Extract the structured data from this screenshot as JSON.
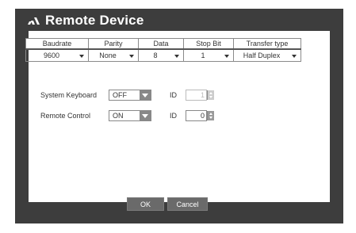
{
  "title": "Remote Device",
  "table": {
    "headers": [
      "Baudrate",
      "Parity",
      "Data",
      "Stop Bit",
      "Transfer type"
    ],
    "values": [
      "9600",
      "None",
      "8",
      "1",
      "Half Duplex"
    ]
  },
  "system_keyboard": {
    "label": "System Keyboard",
    "value": "OFF",
    "id_label": "ID",
    "id_value": "1",
    "id_enabled": false
  },
  "remote_control": {
    "label": "Remote Control",
    "value": "ON",
    "id_label": "ID",
    "id_value": "0",
    "id_enabled": true
  },
  "buttons": {
    "ok": "OK",
    "cancel": "Cancel"
  }
}
